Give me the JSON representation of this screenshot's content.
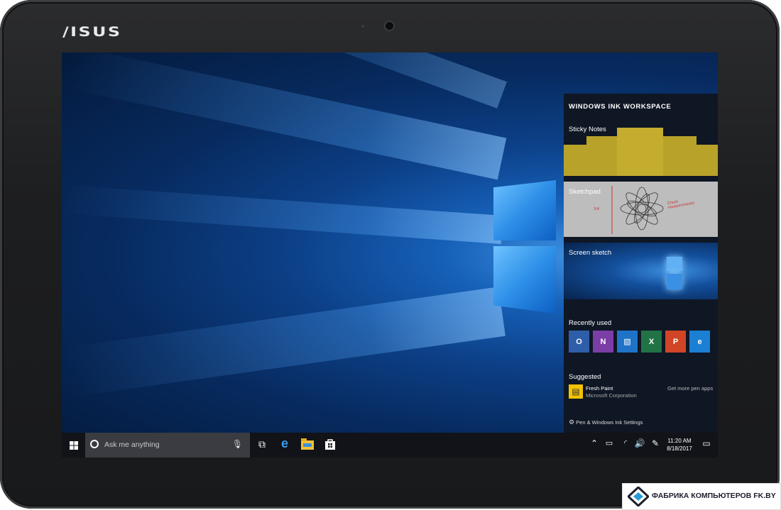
{
  "device": {
    "brand": "/ISUS"
  },
  "ink_workspace": {
    "title": "WINDOWS INK WORKSPACE",
    "sticky_notes_label": "Sticky Notes",
    "sketchpad_label": "Sketchpad",
    "sketchpad_note": "Check measurements!",
    "screen_sketch_label": "Screen sketch",
    "recently_used_label": "Recently used",
    "recently_used_apps": [
      {
        "name": "outlook-icon",
        "glyph": "O",
        "color": "#2f5ea8"
      },
      {
        "name": "onenote-icon",
        "glyph": "N",
        "color": "#7b3ea6"
      },
      {
        "name": "photos-icon",
        "glyph": "▧",
        "color": "#1f73c7"
      },
      {
        "name": "excel-icon",
        "glyph": "X",
        "color": "#217346"
      },
      {
        "name": "powerpoint-icon",
        "glyph": "P",
        "color": "#d04525"
      },
      {
        "name": "edge-icon",
        "glyph": "e",
        "color": "#1b7fd4"
      }
    ],
    "suggested_label": "Suggested",
    "suggested_app": {
      "name": "Fresh Paint",
      "publisher": "Microsoft Corporation"
    },
    "get_more_link": "Get more pen apps",
    "settings_link": "Pen & Windows Ink Settings"
  },
  "taskbar": {
    "search_placeholder": "Ask me anything",
    "clock_time": "11:20 AM",
    "clock_date": "8/18/2017"
  },
  "watermark": {
    "text": "ФАБРИКА КОМПЬЮТЕРОВ FK.BY"
  }
}
